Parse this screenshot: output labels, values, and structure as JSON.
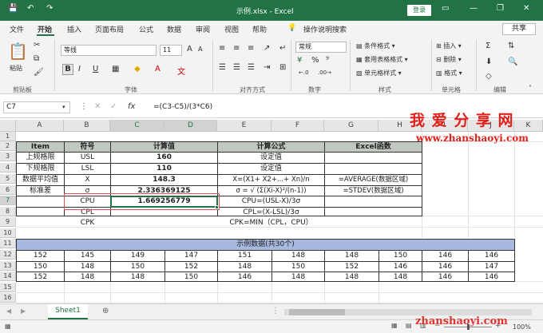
{
  "titlebar": {
    "undo": "↶",
    "redo": "↷",
    "save": "💾",
    "title": "示例.xlsx  -  Excel",
    "login": "登录",
    "min": "—",
    "restore": "❐",
    "close": "✕",
    "ribbon_opt": "▭"
  },
  "tabs": {
    "file": "文件",
    "home": "开始",
    "insert": "插入",
    "layout": "页面布局",
    "formulas": "公式",
    "data": "数据",
    "review": "审阅",
    "view": "视图",
    "help": "帮助",
    "search": "操作说明搜索",
    "share": "共享"
  },
  "ribbon": {
    "paste": "粘贴",
    "clipboard": "剪贴板",
    "font_name": "等线",
    "font_size": "11",
    "font_group": "字体",
    "bold": "B",
    "italic": "I",
    "underline": "U",
    "align_group": "对齐方式",
    "number_format": "常规",
    "percent": "%",
    "number_group": "数字",
    "cond_format": "条件格式",
    "table_format": "套用表格格式",
    "cell_style": "单元格样式",
    "style_group": "样式",
    "insert": "插入",
    "delete": "删除",
    "format": "格式",
    "cells_group": "单元格",
    "edit_group": "编辑"
  },
  "formula_bar": {
    "name_box": "C7",
    "fx": "fx",
    "formula": "=(C3-C5)/(3*C6)"
  },
  "columns": [
    "A",
    "B",
    "C",
    "D",
    "E",
    "F",
    "G",
    "H",
    "I",
    "J",
    "K"
  ],
  "rows": [
    "1",
    "2",
    "3",
    "4",
    "5",
    "6",
    "7",
    "8",
    "9",
    "10",
    "11",
    "12",
    "13",
    "14",
    "15",
    "16",
    "17"
  ],
  "table": {
    "header": {
      "item": "Item",
      "symbol": "符号",
      "value": "计算值",
      "formula": "计算公式",
      "excel": "Excel函数"
    },
    "rows": [
      {
        "item": "上规格限",
        "symbol": "USL",
        "value": "160",
        "formula": "设定值",
        "excel": ""
      },
      {
        "item": "下规格限",
        "symbol": "LSL",
        "value": "110",
        "formula": "设定值",
        "excel": ""
      },
      {
        "item": "数据平均值",
        "symbol": "X",
        "value": "148.3",
        "formula": "X=(X1+ X2+...+ Xn)/n",
        "excel": "=AVERAGE(数据区域)"
      },
      {
        "item": "标准差",
        "symbol": "σ",
        "value": "2.336369125",
        "formula": "σ = √ (Σ(Xi-X)²/(n-1))",
        "excel": "=STDEV(数据区域)"
      },
      {
        "item": "",
        "symbol": "CPU",
        "value": "1.669256779",
        "formula": "CPU=(USL-X)/3σ",
        "excel": ""
      },
      {
        "item": "",
        "symbol": "CPL",
        "value": "",
        "formula": "CPL=(X-LSL)/3σ",
        "excel": ""
      },
      {
        "item": "",
        "symbol": "CPK",
        "value": "",
        "formula": "CPK=MIN（CPL，CPU）",
        "excel": ""
      }
    ]
  },
  "sample": {
    "title": "示例数据(共30个)",
    "rows": [
      [
        "152",
        "145",
        "149",
        "147",
        "151",
        "148",
        "148",
        "150",
        "146",
        "146"
      ],
      [
        "150",
        "148",
        "150",
        "152",
        "148",
        "150",
        "152",
        "146",
        "146",
        "147"
      ],
      [
        "152",
        "148",
        "148",
        "150",
        "146",
        "148",
        "148",
        "148",
        "146",
        "146"
      ]
    ]
  },
  "watermark": {
    "title": "我 爱 分 享 网",
    "url": "www.zhanshaoyi.com",
    "url_bottom": "zhanshaoyi.com"
  },
  "sheetbar": {
    "prev": "◀",
    "next": "▶",
    "sheet": "Sheet1",
    "add": "⊕"
  },
  "status": {
    "zoom": "100%",
    "minus": "−",
    "plus": "+"
  },
  "colors": {
    "excel_green": "#217346",
    "header_fill": "#c0c9c0",
    "sample_fill": "#a7b9de",
    "watermark_red": "#e0201b"
  }
}
